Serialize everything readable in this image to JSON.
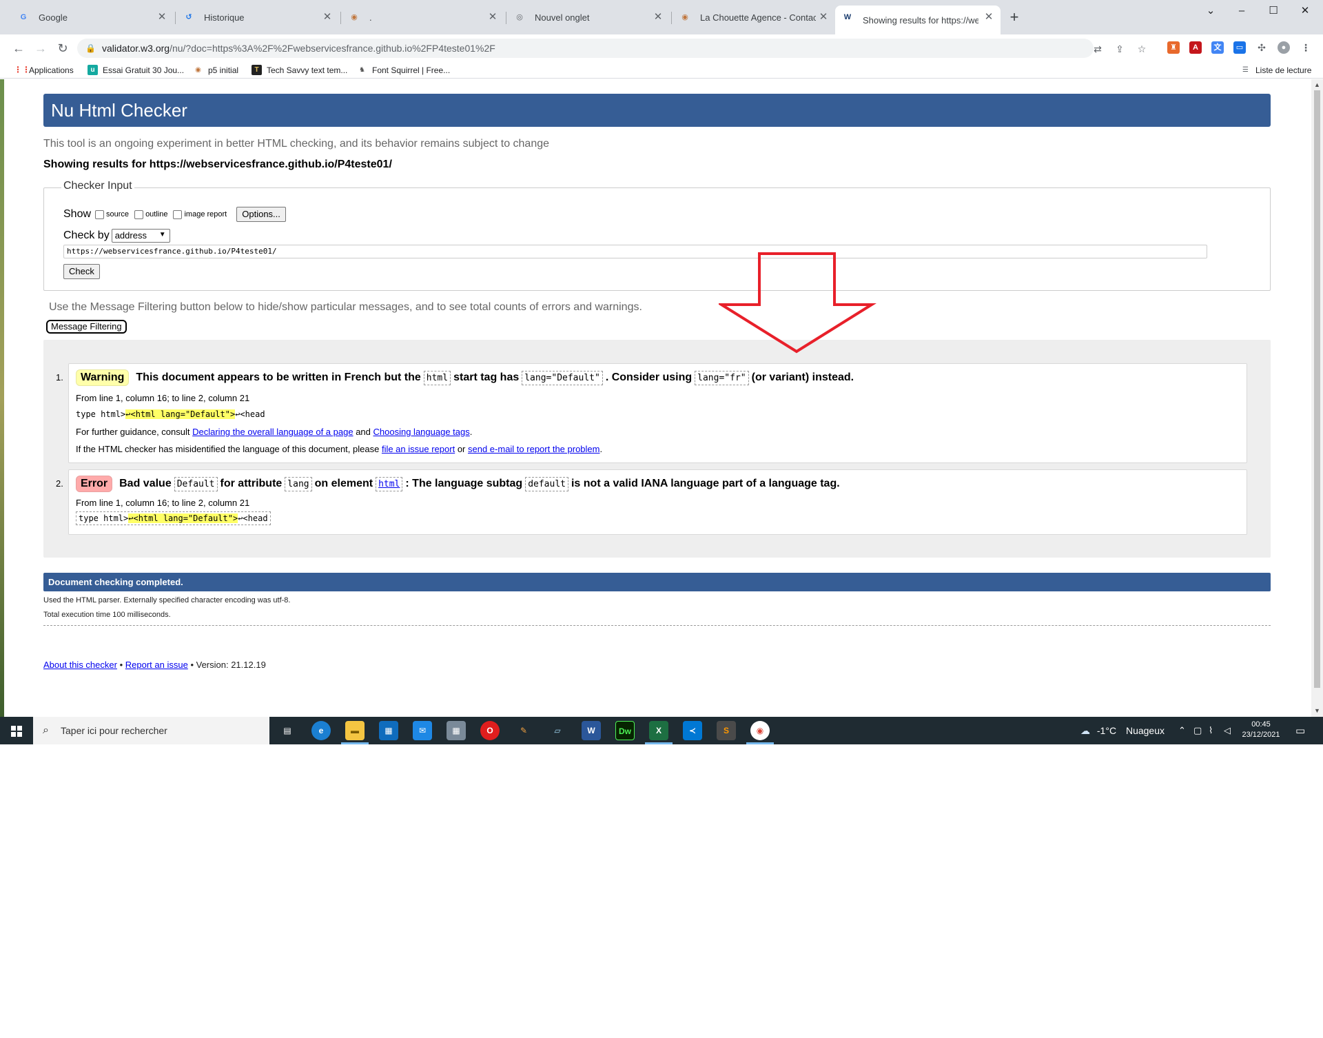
{
  "tabs": [
    {
      "title": "Google",
      "favicon": "google-icon",
      "close": "✕"
    },
    {
      "title": "Historique",
      "favicon": "history-icon",
      "close": "✕"
    },
    {
      "title": ".",
      "favicon": "owl-icon",
      "close": "✕"
    },
    {
      "title": "Nouvel onglet",
      "favicon": "chrome-icon",
      "close": "✕"
    },
    {
      "title": "La Chouette Agence - Contact",
      "favicon": "owl-icon",
      "close": "✕"
    },
    {
      "title": "Showing results for https://webse",
      "favicon": "w3c-icon",
      "close": "✕"
    }
  ],
  "toolbar": {
    "url_host": "validator.w3.org",
    "url_path": "/nu/?doc=https%3A%2F%2Fwebservicesfrance.github.io%2FP4teste01%2F"
  },
  "bookmarks": {
    "apps": "Applications",
    "items": [
      "Essai Gratuit 30 Jou...",
      "p5 initial",
      "Tech Savvy text tem...",
      "Font Squirrel | Free..."
    ],
    "reading_list": "Liste de lecture"
  },
  "page": {
    "title": "Nu Html Checker",
    "intro": "This tool is an ongoing experiment in better HTML checking, and its behavior remains subject to change",
    "showing": "Showing results for https://webservicesfrance.github.io/P4teste01/",
    "checker_legend": "Checker Input",
    "show_label": "Show",
    "show_options": [
      "source",
      "outline",
      "image report"
    ],
    "options_button": "Options...",
    "checkby_label": "Check by",
    "checkby_value": "address",
    "doc_value": "https://webservicesfrance.github.io/P4teste01/",
    "check_button": "Check",
    "filter_text": "Use the Message Filtering button below to hide/show particular messages, and to see total counts of errors and warnings.",
    "filter_button": "Message Filtering"
  },
  "messages": [
    {
      "num": "1.",
      "badge": "Warning",
      "t1": "This document appears to be written in French but the",
      "c1": "html",
      "t2": "start tag has",
      "c2": "lang=\"Default\"",
      "t3": ". Consider using",
      "c3": "lang=\"fr\"",
      "t4": "(or variant) instead.",
      "location": "From line 1, column 16; to line 2, column 21",
      "ext_pre": "type html>",
      "ext_hl": "↩<html lang=\"Default\">",
      "ext_post": "↩<head",
      "guidance_pre": "For further guidance, consult",
      "guidance_link1": "Declaring the overall language of a page",
      "guidance_and": "and",
      "guidance_link2": "Choosing language tags",
      "guidance_end": ".",
      "misid_pre": "If the HTML checker has misidentified the language of this document, please",
      "misid_link1": "file an issue report",
      "misid_or": "or",
      "misid_link2": "send e-mail to report the problem",
      "misid_end": "."
    },
    {
      "num": "2.",
      "badge": "Error",
      "t1": "Bad value",
      "c1": "Default",
      "t2": "for attribute",
      "c2": "lang",
      "t3": "on element",
      "c3": "html",
      "t4": ": The language subtag",
      "c4": "default",
      "t5": "is not a valid IANA language part of a language tag.",
      "location": "From line 1, column 16; to line 2, column 21",
      "ext_pre": "type html>",
      "ext_hl": "↩<html lang=\"Default\">",
      "ext_post": "↩<head"
    }
  ],
  "completion": {
    "title": "Document checking completed.",
    "parser": "Used the HTML parser. Externally specified character encoding was utf-8.",
    "time": "Total execution time 100 milliseconds."
  },
  "footer": {
    "about": "About this checker",
    "sep1": "•",
    "report": "Report an issue",
    "version": "• Version: 21.12.19"
  },
  "taskbar": {
    "search_placeholder": "Taper ici pour rechercher",
    "weather_temp": "-1°C",
    "weather_text": "Nuageux",
    "time": "00:45",
    "date": "23/12/2021"
  },
  "colors": {
    "banner": "#365d95",
    "warning_badge": "#ffffaa",
    "error_badge": "#ffaaaa",
    "highlight": "#ffff66",
    "annotation_arrow": "#e8202a"
  }
}
